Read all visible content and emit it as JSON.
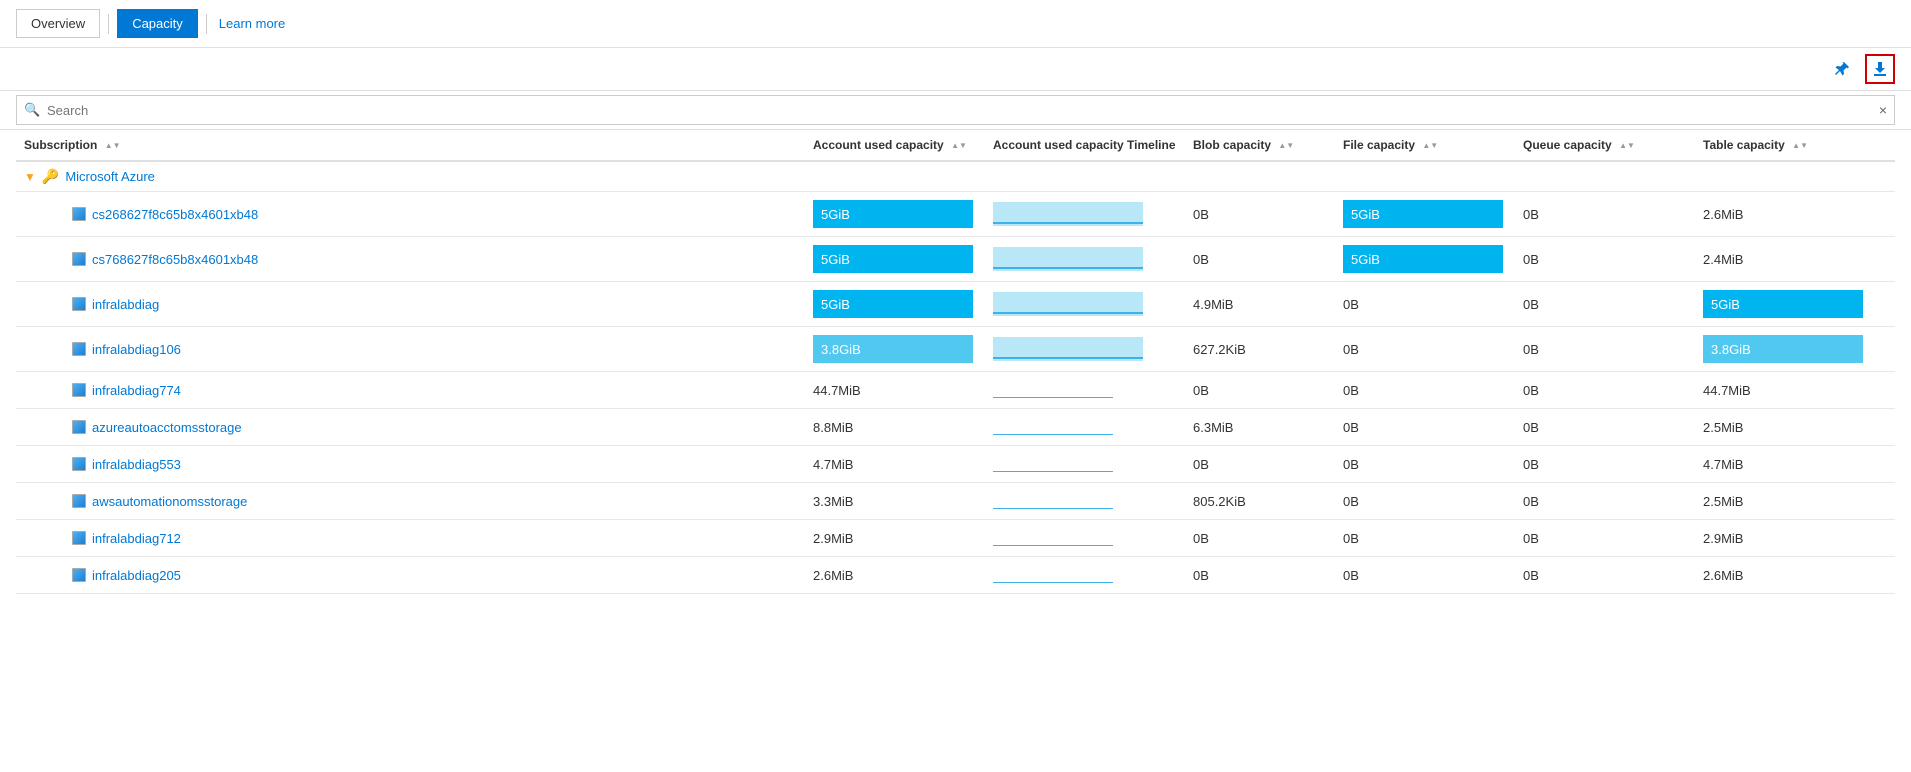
{
  "nav": {
    "overview_label": "Overview",
    "capacity_label": "Capacity",
    "learn_more_label": "Learn more"
  },
  "toolbar": {
    "pin_title": "Pin",
    "download_title": "Download"
  },
  "search": {
    "placeholder": "Search",
    "clear_label": "×"
  },
  "table": {
    "columns": [
      {
        "key": "subscription",
        "label": "Subscription"
      },
      {
        "key": "account_used_capacity",
        "label": "Account used capacity"
      },
      {
        "key": "account_used_capacity_timeline",
        "label": "Account used capacity Timeline"
      },
      {
        "key": "blob_capacity",
        "label": "Blob capacity"
      },
      {
        "key": "file_capacity",
        "label": "File capacity"
      },
      {
        "key": "queue_capacity",
        "label": "Queue capacity"
      },
      {
        "key": "table_capacity",
        "label": "Table capacity"
      }
    ],
    "group": {
      "name": "Microsoft Azure",
      "icon": "key"
    },
    "rows": [
      {
        "account": "cs268627f8c65b8x4601xb48",
        "account_used_capacity": "5GiB",
        "account_used_capacity_bar": true,
        "account_timeline": "bar",
        "blob_capacity": "0B",
        "file_capacity": "5GiB",
        "file_capacity_bar": true,
        "queue_capacity": "0B",
        "table_capacity": "2.6MiB",
        "table_capacity_bar": false
      },
      {
        "account": "cs768627f8c65b8x4601xb48",
        "account_used_capacity": "5GiB",
        "account_used_capacity_bar": true,
        "account_timeline": "bar",
        "blob_capacity": "0B",
        "file_capacity": "5GiB",
        "file_capacity_bar": true,
        "queue_capacity": "0B",
        "table_capacity": "2.4MiB",
        "table_capacity_bar": false
      },
      {
        "account": "infralabdiag",
        "account_used_capacity": "5GiB",
        "account_used_capacity_bar": true,
        "account_timeline": "bar",
        "blob_capacity": "4.9MiB",
        "file_capacity": "0B",
        "file_capacity_bar": false,
        "queue_capacity": "0B",
        "table_capacity": "5GiB",
        "table_capacity_bar": true
      },
      {
        "account": "infralabdiag106",
        "account_used_capacity": "3.8GiB",
        "account_used_capacity_bar": true,
        "account_used_capacity_partial": true,
        "account_timeline": "bar",
        "blob_capacity": "627.2KiB",
        "file_capacity": "0B",
        "file_capacity_bar": false,
        "queue_capacity": "0B",
        "table_capacity": "3.8GiB",
        "table_capacity_bar": true,
        "table_capacity_partial": true
      },
      {
        "account": "infralabdiag774",
        "account_used_capacity": "44.7MiB",
        "account_used_capacity_bar": false,
        "account_timeline": "line",
        "blob_capacity": "0B",
        "file_capacity": "0B",
        "file_capacity_bar": false,
        "queue_capacity": "0B",
        "table_capacity": "44.7MiB",
        "table_capacity_bar": false
      },
      {
        "account": "azureautoacctomsstorage",
        "account_used_capacity": "8.8MiB",
        "account_used_capacity_bar": false,
        "account_timeline": "line",
        "blob_capacity": "6.3MiB",
        "file_capacity": "0B",
        "file_capacity_bar": false,
        "queue_capacity": "0B",
        "table_capacity": "2.5MiB",
        "table_capacity_bar": false
      },
      {
        "account": "infralabdiag553",
        "account_used_capacity": "4.7MiB",
        "account_used_capacity_bar": false,
        "account_timeline": "line",
        "blob_capacity": "0B",
        "file_capacity": "0B",
        "file_capacity_bar": false,
        "queue_capacity": "0B",
        "table_capacity": "4.7MiB",
        "table_capacity_bar": false
      },
      {
        "account": "awsautomationomsstorage",
        "account_used_capacity": "3.3MiB",
        "account_used_capacity_bar": false,
        "account_timeline": "line",
        "blob_capacity": "805.2KiB",
        "file_capacity": "0B",
        "file_capacity_bar": false,
        "queue_capacity": "0B",
        "table_capacity": "2.5MiB",
        "table_capacity_bar": false
      },
      {
        "account": "infralabdiag712",
        "account_used_capacity": "2.9MiB",
        "account_used_capacity_bar": false,
        "account_timeline": "line",
        "blob_capacity": "0B",
        "file_capacity": "0B",
        "file_capacity_bar": false,
        "queue_capacity": "0B",
        "table_capacity": "2.9MiB",
        "table_capacity_bar": false
      },
      {
        "account": "infralabdiag205",
        "account_used_capacity": "2.6MiB",
        "account_used_capacity_bar": false,
        "account_timeline": "line",
        "blob_capacity": "0B",
        "file_capacity": "0B",
        "file_capacity_bar": false,
        "queue_capacity": "0B",
        "table_capacity": "2.6MiB",
        "table_capacity_bar": false
      }
    ]
  },
  "colors": {
    "blue": "#0078d4",
    "bar_blue": "#00b4f0",
    "bar_partial": "#50c8f0",
    "bar_timeline": "#b8e8f8",
    "bar_timeline_line": "#40b0e8"
  }
}
